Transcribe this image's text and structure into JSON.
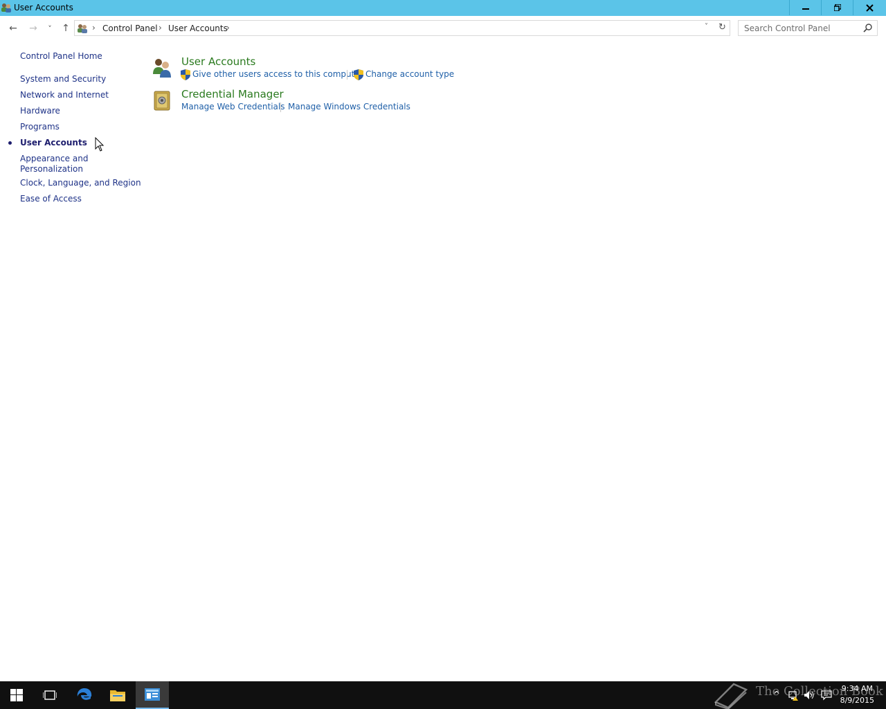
{
  "window": {
    "title": "User Accounts",
    "minimize_glyph": "‒",
    "maximize_glyph": "❐",
    "close_glyph": "✕"
  },
  "navigation": {
    "back_glyph": "←",
    "forward_glyph": "→",
    "recent_glyph": "˅",
    "up_glyph": "↑",
    "breadcrumbs": [
      "Control Panel",
      "User Accounts"
    ],
    "separator": "›",
    "dropdown_glyph": "˅",
    "refresh_glyph": "↻",
    "search_placeholder": "Search Control Panel"
  },
  "sidebar": {
    "home": "Control Panel Home",
    "items": [
      {
        "label": "System and Security"
      },
      {
        "label": "Network and Internet"
      },
      {
        "label": "Hardware"
      },
      {
        "label": "Programs"
      },
      {
        "label": "User Accounts",
        "current": true
      },
      {
        "label_line1": "Appearance and",
        "label_line2": "Personalization"
      },
      {
        "label": "Clock, Language, and Region"
      },
      {
        "label": "Ease of Access"
      }
    ]
  },
  "categories": [
    {
      "title": "User Accounts",
      "icon": "users-icon",
      "tasks": [
        {
          "label": "Give other users access to this computer",
          "shield": true
        },
        {
          "label": "Change account type",
          "shield": true
        }
      ]
    },
    {
      "title": "Credential Manager",
      "icon": "vault-icon",
      "tasks": [
        {
          "label": "Manage Web Credentials",
          "shield": false
        },
        {
          "label": "Manage Windows Credentials",
          "shield": false
        }
      ]
    }
  ],
  "taskbar": {
    "apps": [
      "start-button",
      "task-view-icon",
      "edge-icon",
      "file-explorer-icon",
      "control-panel-icon"
    ],
    "watermark": "The Collection Book",
    "time": "9:34 AM",
    "date": "8/9/2015"
  },
  "colors": {
    "titlebar": "#5bc4e8",
    "link": "#1e3287",
    "category_title": "#2a7a1e",
    "task_link": "#2060a8",
    "taskbar": "#101010"
  }
}
